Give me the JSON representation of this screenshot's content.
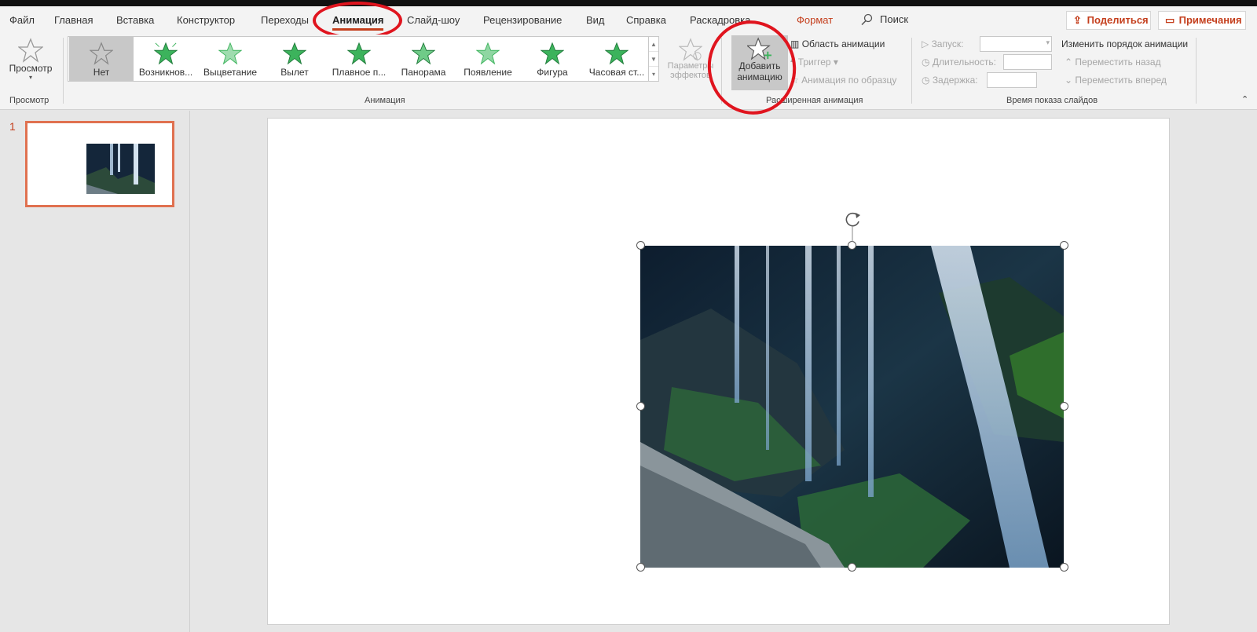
{
  "tabs": [
    {
      "label": "Файл"
    },
    {
      "label": "Главная"
    },
    {
      "label": "Вставка"
    },
    {
      "label": "Конструктор"
    },
    {
      "label": "Переходы"
    },
    {
      "label": "Анимация"
    },
    {
      "label": "Слайд-шоу"
    },
    {
      "label": "Рецензирование"
    },
    {
      "label": "Вид"
    },
    {
      "label": "Справка"
    },
    {
      "label": "Раскадровка"
    },
    {
      "label": "Формат"
    }
  ],
  "active_tab": "Анимация",
  "search_label": "Поиск",
  "share_label": "Поделиться",
  "notes_label": "Примечания",
  "preview": {
    "label": "Просмотр",
    "group": "Просмотр"
  },
  "animation_group": {
    "label": "Анимация",
    "items": [
      {
        "label": "Нет"
      },
      {
        "label": "Возникнов..."
      },
      {
        "label": "Выцветание"
      },
      {
        "label": "Вылет"
      },
      {
        "label": "Плавное п..."
      },
      {
        "label": "Панорама"
      },
      {
        "label": "Появление"
      },
      {
        "label": "Фигура"
      },
      {
        "label": "Часовая ст..."
      }
    ],
    "effect_options": {
      "line1": "Параметры",
      "line2": "эффектов"
    }
  },
  "advanced_group": {
    "label": "Расширенная анимация",
    "add_line1": "Добавить",
    "add_line2": "анимацию",
    "pane": "Область анимации",
    "trigger": "Триггер",
    "painter": "Анимация по образцу"
  },
  "timing_group": {
    "label": "Время показа слайдов",
    "start": "Запуск:",
    "duration": "Длительность:",
    "delay": "Задержка:",
    "reorder": "Изменить порядок анимации",
    "move_back": "Переместить назад",
    "move_forward": "Переместить вперед"
  },
  "slides": [
    {
      "number": "1"
    }
  ],
  "colors": {
    "accent": "#c43e1c",
    "annotation": "#e0141e",
    "star_green": "#3cb35c"
  },
  "icons": [
    "search-icon",
    "share-icon",
    "comment-icon",
    "star-icon",
    "rotate-icon"
  ]
}
